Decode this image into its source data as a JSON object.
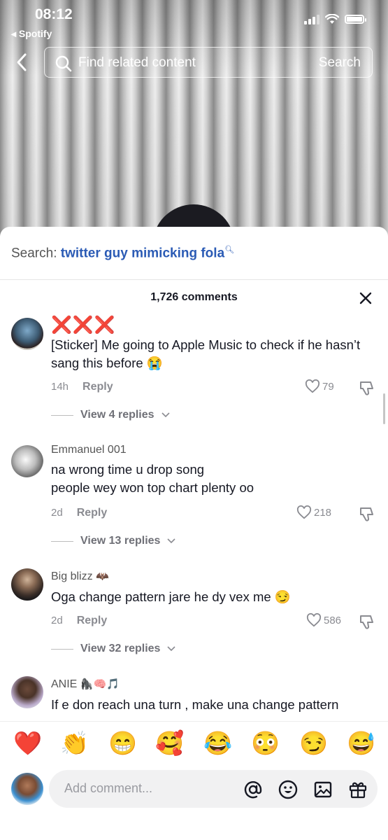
{
  "status_bar": {
    "time": "08:12",
    "back_app": "◂ Spotify"
  },
  "search": {
    "placeholder": "Find related content",
    "button": "Search"
  },
  "sheet": {
    "related_prefix": "Search: ",
    "related_query": "twitter guy mimicking fola",
    "comment_count": "1,726 comments"
  },
  "comments": [
    {
      "username": "❌❌❌",
      "text": "[Sticker] Me going to Apple Music to check if he hasn’t sang this before 😭",
      "time": "14h",
      "reply": "Reply",
      "likes": "79",
      "view_replies": "View 4 replies"
    },
    {
      "username": "Emmanuel 001",
      "text_line1": "na wrong time u drop song",
      "text_line2": "people wey won top chart plenty oo",
      "time": "2d",
      "reply": "Reply",
      "likes": "218",
      "view_replies": "View 13 replies"
    },
    {
      "username": "Big blizz",
      "username_emoji": "🦇",
      "text": "Oga change pattern jare he dy vex me 😏",
      "time": "2d",
      "reply": "Reply",
      "likes": "586",
      "view_replies": "View 32 replies"
    },
    {
      "username": "ANIE",
      "username_emoji": "🦍🧠🎵",
      "text": "If e don reach una turn , make una change pattern"
    }
  ],
  "emoji_bar": [
    "❤️",
    "👏",
    "😁",
    "🥰",
    "😂",
    "😳",
    "😏",
    "😅"
  ],
  "comment_input": {
    "placeholder": "Add comment..."
  },
  "colors": {
    "accent_link": "#2b5bb5",
    "username_red": "#e3151e",
    "meta_gray": "#8a8b91"
  }
}
